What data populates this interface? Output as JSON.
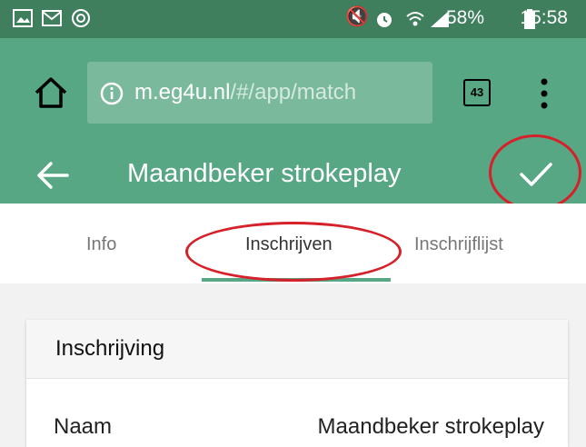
{
  "status_bar": {
    "battery": "58%",
    "time": "15:58",
    "icons": [
      "image-icon",
      "mail-icon",
      "sync-icon",
      "mute-icon",
      "alarm-icon",
      "wifi-icon",
      "signal-icon",
      "battery-icon"
    ]
  },
  "browser": {
    "url_domain": "m.eg4u.nl",
    "url_path": "/#/app/match",
    "tab_count": "43"
  },
  "app_bar": {
    "title": "Maandbeker strokeplay"
  },
  "tabs": [
    {
      "label": "Info"
    },
    {
      "label": "Inschrijven",
      "active": true
    },
    {
      "label": "Inschrijflijst"
    }
  ],
  "card": {
    "header": "Inschrijving",
    "rows": [
      {
        "label": "Naam",
        "value": "Maandbeker strokeplay"
      }
    ]
  },
  "colors": {
    "status_bar": "#3f7f5e",
    "toolbar": "#57a684",
    "highlight": "#d6202a"
  }
}
